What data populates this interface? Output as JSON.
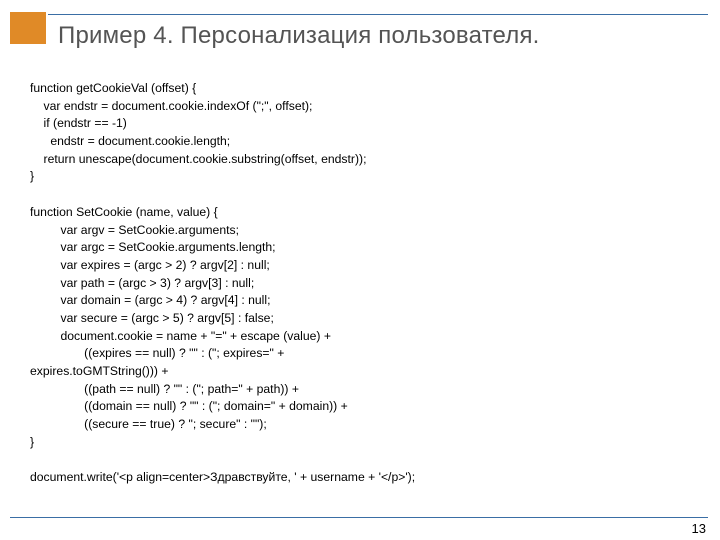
{
  "title": "Пример 4. Персонализация пользователя.",
  "page_number": "13",
  "code": "function getCookieVal (offset) {\n    var endstr = document.cookie.indexOf (\";\", offset);\n    if (endstr == -1)\n      endstr = document.cookie.length;\n    return unescape(document.cookie.substring(offset, endstr));\n}\n\nfunction SetCookie (name, value) {\n         var argv = SetCookie.arguments;\n         var argc = SetCookie.arguments.length;\n         var expires = (argc > 2) ? argv[2] : null;\n         var path = (argc > 3) ? argv[3] : null;\n         var domain = (argc > 4) ? argv[4] : null;\n         var secure = (argc > 5) ? argv[5] : false;\n         document.cookie = name + \"=\" + escape (value) +\n                ((expires == null) ? \"\" : (\"; expires=\" +\nexpires.toGMTString())) +\n                ((path == null) ? \"\" : (\"; path=\" + path)) +\n                ((domain == null) ? \"\" : (\"; domain=\" + domain)) +\n                ((secure == true) ? \"; secure\" : \"\");\n}\n\ndocument.write('<p align=center>Здравствуйте, ' + username + '</p>');"
}
